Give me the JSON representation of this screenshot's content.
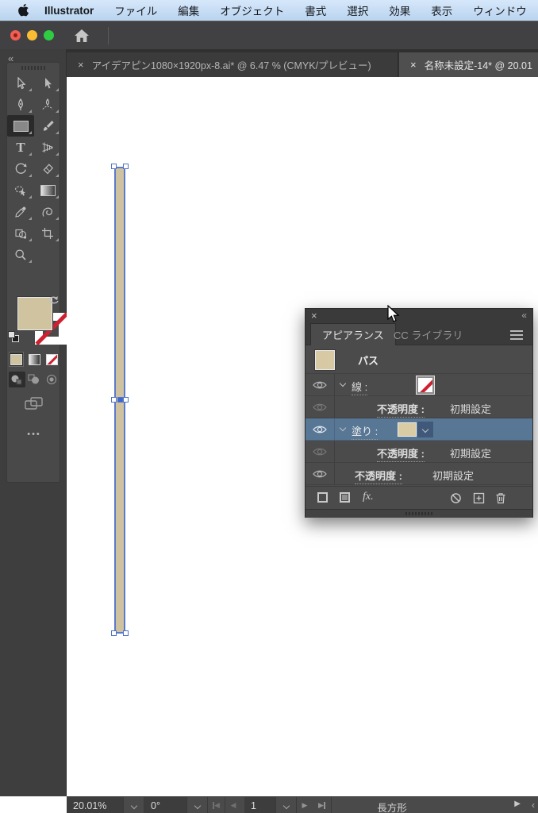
{
  "menu_bar": {
    "app_name": "Illustrator",
    "items": [
      "ファイル",
      "編集",
      "オブジェクト",
      "書式",
      "選択",
      "効果",
      "表示",
      "ウィンドウ"
    ]
  },
  "document_tabs": [
    {
      "close": "×",
      "label": "アイデアピン1080×1920px-8.ai* @ 6.47 % (CMYK/プレビュー)",
      "active": false
    },
    {
      "close": "×",
      "label": "名称未設定-14* @ 20.01",
      "active": true
    }
  ],
  "tools_panel": {
    "collapse_icon": "«",
    "tools": [
      "selection",
      "direct-selection",
      "pen",
      "curvature",
      "rectangle",
      "paintbrush",
      "type",
      "perspective-grid",
      "rotate",
      "eraser",
      "shaper",
      "gradient",
      "eyedropper",
      "blend",
      "shape-builder",
      "artboard",
      "zoom"
    ],
    "active_tool": "rectangle",
    "type_glyph": "T",
    "ellipsis": "•••"
  },
  "canvas": {
    "object": {
      "type": "rectangle",
      "fill_color": "#cfc2a1",
      "selection_color": "#5b7ac9"
    }
  },
  "appearance_panel": {
    "close_icon": "×",
    "collapse_icon": "«",
    "tabs": [
      {
        "label": "アピアランス",
        "active": true
      },
      {
        "label": "CC ライブラリ",
        "active": false
      }
    ],
    "target_label": "パス",
    "rows": {
      "stroke": {
        "label": "線 :",
        "swatch": "none"
      },
      "stroke_opacity": {
        "label": "不透明度 :",
        "value": "初期設定"
      },
      "fill": {
        "label": "塗り :",
        "swatch": "#d9cba4",
        "selected": true
      },
      "fill_opacity": {
        "label": "不透明度 :",
        "value": "初期設定"
      },
      "path_opacity": {
        "label": "不透明度 :",
        "value": "初期設定"
      }
    },
    "footer": {
      "fx_label": "fx.",
      "icons": [
        "add-new-stroke",
        "add-new-fill",
        "add-new-effect",
        "clear-appearance",
        "duplicate-selected-item",
        "delete-selected-item"
      ]
    }
  },
  "status_bar": {
    "zoom_level": "20.01%",
    "rotation": "0°",
    "artboard_number": "1",
    "selected_object": "長方形",
    "right_arrow": "▶",
    "corner_collapse": "‹"
  },
  "colors": {
    "fill_tan": "#cfc3a0",
    "selection_blue": "#5b7ac9",
    "selected_row_blue": "#587795",
    "menu_bar_blue": "#bdd7f1",
    "panel_gray": "#4b4b4b"
  }
}
